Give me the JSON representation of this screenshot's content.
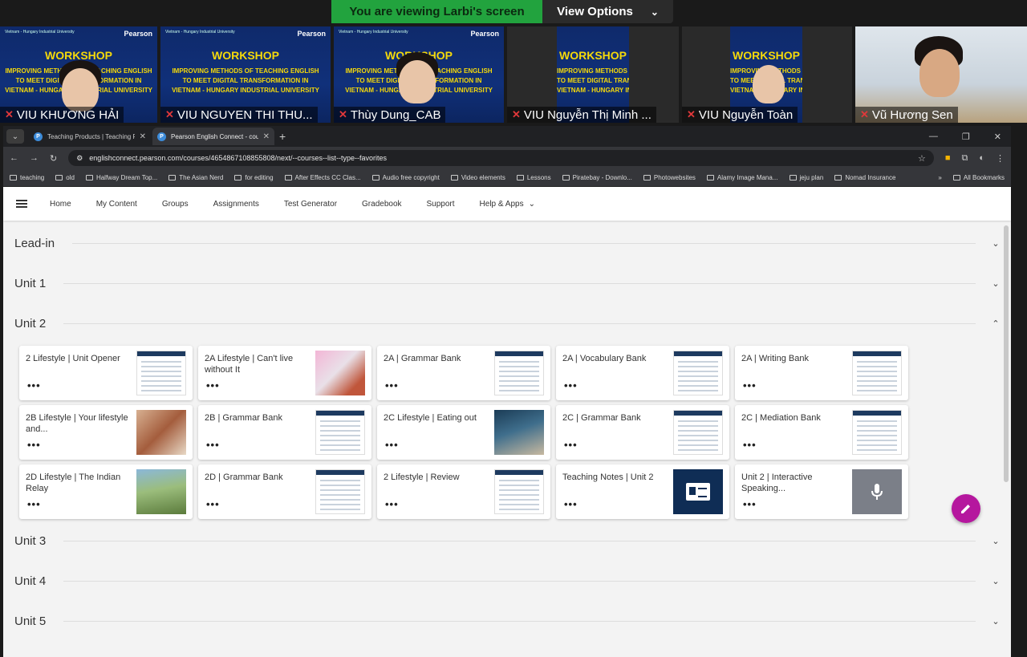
{
  "zoom": {
    "viewing_text": "You are viewing Larbi's screen",
    "view_options": "View Options",
    "participants": [
      {
        "name": "VIU KHƯƠNG HẢI",
        "muted": false
      },
      {
        "name": "VIU NGUYEN THI THU...",
        "muted": true
      },
      {
        "name": "Thùy Dung_CAB",
        "muted": true
      },
      {
        "name": "VIU Nguyễn Thị Minh ...",
        "muted": true
      },
      {
        "name": "VIU Nguyễn Toàn",
        "muted": true
      },
      {
        "name": "Vũ Hương Sen",
        "muted": true
      }
    ],
    "slide": {
      "header": "Vietnam - Hungary Industrial University",
      "brand": "Pearson",
      "title": "WORKSHOP",
      "line1": "IMPROVING METHODS OF TEACHING ENGLISH",
      "line2": "TO MEET DIGITAL TRANSFORMATION IN",
      "line3": "VIETNAM - HUNGARY INDUSTRIAL UNIVERSITY"
    }
  },
  "browser": {
    "tabs": [
      {
        "title": "Teaching Products | Teaching P",
        "active": false
      },
      {
        "title": "Pearson English Connect - cou",
        "active": true
      }
    ],
    "url": "englishconnect.pearson.com/courses/4654867108855808/next/--courses--list--type--favorites",
    "bookmarks": [
      "teaching",
      "old",
      "Halfway Dream Top...",
      "The Asian Nerd",
      "for editing",
      "After Effects CC Clas...",
      "Audio free copyright",
      "Video elements",
      "Lessons",
      "Piratebay - Downlo...",
      "Photowebsites",
      "Alamy Image Mana...",
      "jeju plan",
      "Nomad Insurance"
    ],
    "all_bookmarks": "All Bookmarks"
  },
  "nav": {
    "items": [
      "Home",
      "My Content",
      "Groups",
      "Assignments",
      "Test Generator",
      "Gradebook",
      "Support",
      "Help & Apps"
    ]
  },
  "sections": [
    {
      "label": "Lead-in",
      "expanded": false
    },
    {
      "label": "Unit 1",
      "expanded": false
    },
    {
      "label": "Unit 2",
      "expanded": true
    },
    {
      "label": "Unit 3",
      "expanded": false
    },
    {
      "label": "Unit 4",
      "expanded": false
    },
    {
      "label": "Unit 5",
      "expanded": false
    }
  ],
  "cards": [
    {
      "title": "2 Lifestyle | Unit Opener",
      "thumb": "doc"
    },
    {
      "title": "2A Lifestyle | Can't live without It",
      "thumb": "img-pink"
    },
    {
      "title": "2A | Grammar Bank",
      "thumb": "doc"
    },
    {
      "title": "2A | Vocabulary Bank",
      "thumb": "doc"
    },
    {
      "title": "2A | Writing Bank",
      "thumb": "doc"
    },
    {
      "title": "2B Lifestyle | Your lifestyle and...",
      "thumb": "img-warm"
    },
    {
      "title": "2B | Grammar Bank",
      "thumb": "doc"
    },
    {
      "title": "2C Lifestyle | Eating out",
      "thumb": "img-blue"
    },
    {
      "title": "2C | Grammar Bank",
      "thumb": "doc"
    },
    {
      "title": "2C | Mediation Bank",
      "thumb": "doc"
    },
    {
      "title": "2D Lifestyle | The Indian Relay",
      "thumb": "img-green"
    },
    {
      "title": "2D | Grammar Bank",
      "thumb": "doc"
    },
    {
      "title": "2 Lifestyle | Review",
      "thumb": "doc"
    },
    {
      "title": "Teaching Notes | Unit 2",
      "thumb": "notes"
    },
    {
      "title": "Unit 2 | Interactive Speaking...",
      "thumb": "mic"
    }
  ],
  "card_more": "•••",
  "colors": {
    "fab": "#b5179e",
    "zoom_green": "#22a33e"
  }
}
